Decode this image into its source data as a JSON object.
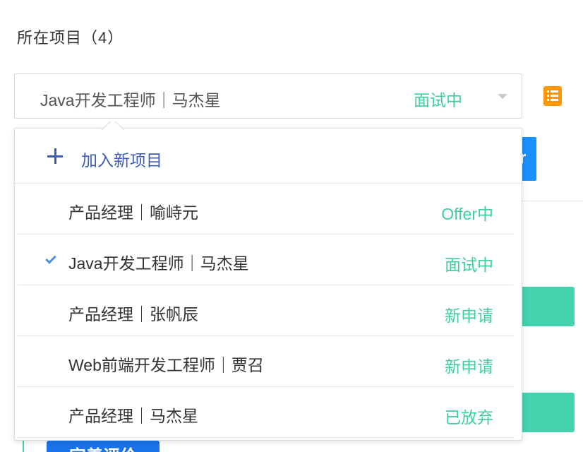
{
  "section": {
    "title": "所在项目（4）"
  },
  "select": {
    "selected_label": "Java开发工程师｜马杰星",
    "selected_status": "面试中"
  },
  "dropdown": {
    "add_label": "加入新项目",
    "options": [
      {
        "label": "产品经理｜喻峙元",
        "status": "Offer中",
        "selected": false
      },
      {
        "label": "Java开发工程师｜马杰星",
        "status": "面试中",
        "selected": true
      },
      {
        "label": "产品经理｜张帆辰",
        "status": "新申请",
        "selected": false
      },
      {
        "label": "Web前端开发工程师｜贾召",
        "status": "新申请",
        "selected": false
      },
      {
        "label": "产品经理｜马杰星",
        "status": "已放弃",
        "selected": false
      }
    ]
  },
  "background": {
    "blue_button_fragment": "r",
    "bottom_button_label": "完善评价"
  },
  "colors": {
    "status_green": "#3ecf9c",
    "accent_blue": "#3d5bb8",
    "check_blue": "#4a90e2",
    "icon_orange": "#ff9800",
    "teal_button": "#43d3ae"
  },
  "icons": {
    "list": "list-icon",
    "caret": "chevron-down-icon",
    "add": "plus-icon",
    "selected": "check-icon"
  }
}
